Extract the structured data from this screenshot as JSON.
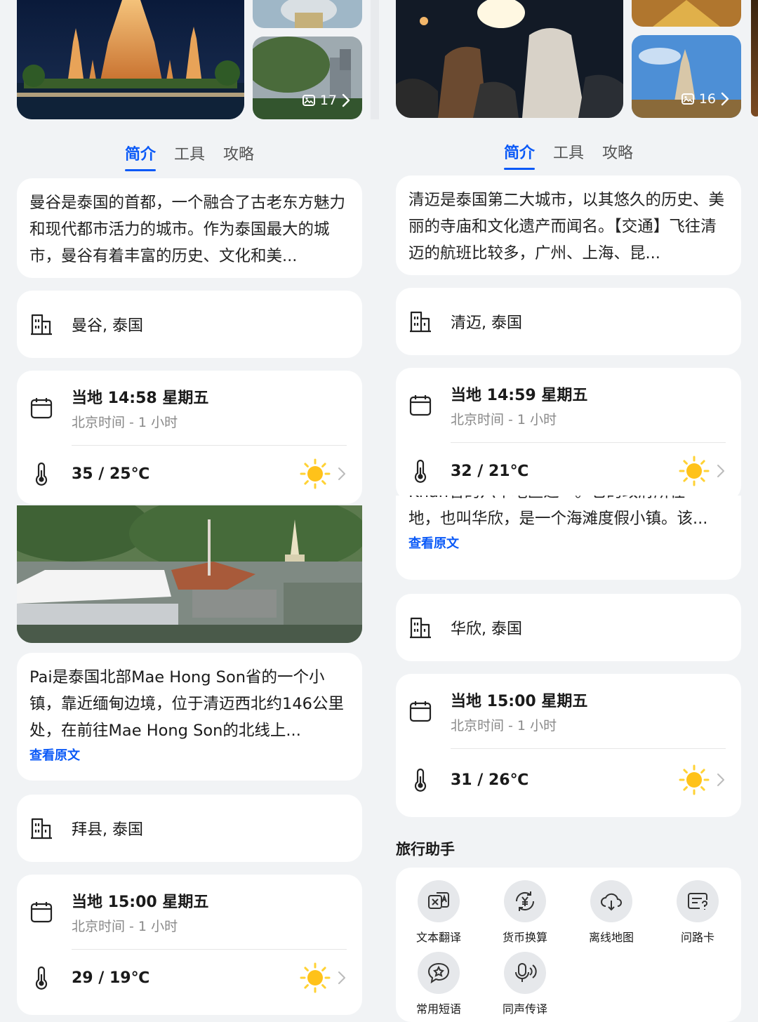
{
  "left": {
    "photo_count": "17",
    "tabs": [
      "简介",
      "工具",
      "攻略"
    ],
    "description": "曼谷是泰国的首都，一个融合了古老东方魅力和现代都市活力的城市。作为泰国最大的城市，曼谷有着丰富的历史、文化和美...",
    "location": "曼谷, 泰国",
    "time": "当地 14:58 星期五",
    "time_diff": "北京时间 - 1 小时",
    "temp": "35 / 25℃",
    "pai_description": "Pai是泰国北部Mae Hong Son省的一个小镇，靠近缅甸边境，位于清迈西北约146公里处，在前往Mae Hong Son的北线上...",
    "pai_readmore": "查看原文",
    "pai_location": "拜县, 泰国",
    "pai_time": "当地 15:00 星期五",
    "pai_time_diff": "北京时间 - 1 小时",
    "pai_temp": "29 / 19℃"
  },
  "right": {
    "photo_count": "16",
    "tabs": [
      "简介",
      "工具",
      "攻略"
    ],
    "description": "清迈是泰国第二大城市，以其悠久的历史、美丽的寺庙和文化遗产而闻名。【交通】飞往清迈的航班比较多，广州、上海、昆...",
    "location": "清迈, 泰国",
    "time": "当地 14:59 星期五",
    "time_diff": "北京时间 - 1 小时",
    "temp": "32 / 21℃",
    "hh_desc_partial": "Khan省的六个地区之一。它的政府所在",
    "hh_description": "地，也叫华欣，是一个海滩度假小镇。该...",
    "hh_readmore": "查看原文",
    "hh_location": "华欣, 泰国",
    "hh_time": "当地 15:00 星期五",
    "hh_time_diff": "北京时间 - 1 小时",
    "hh_temp": "31 / 26℃",
    "assistant_title": "旅行助手",
    "tools": [
      {
        "label": "文本翻译",
        "icon": "translate-icon"
      },
      {
        "label": "货币换算",
        "icon": "currency-icon"
      },
      {
        "label": "离线地图",
        "icon": "offline-map-icon"
      },
      {
        "label": "问路卡",
        "icon": "ask-way-card-icon"
      },
      {
        "label": "常用短语",
        "icon": "phrases-icon"
      },
      {
        "label": "同声传译",
        "icon": "interpret-icon"
      }
    ]
  },
  "colors": {
    "accent": "#0a59f7",
    "background": "#f1f3f5",
    "card": "#ffffff",
    "sun": "#ffc21a"
  }
}
